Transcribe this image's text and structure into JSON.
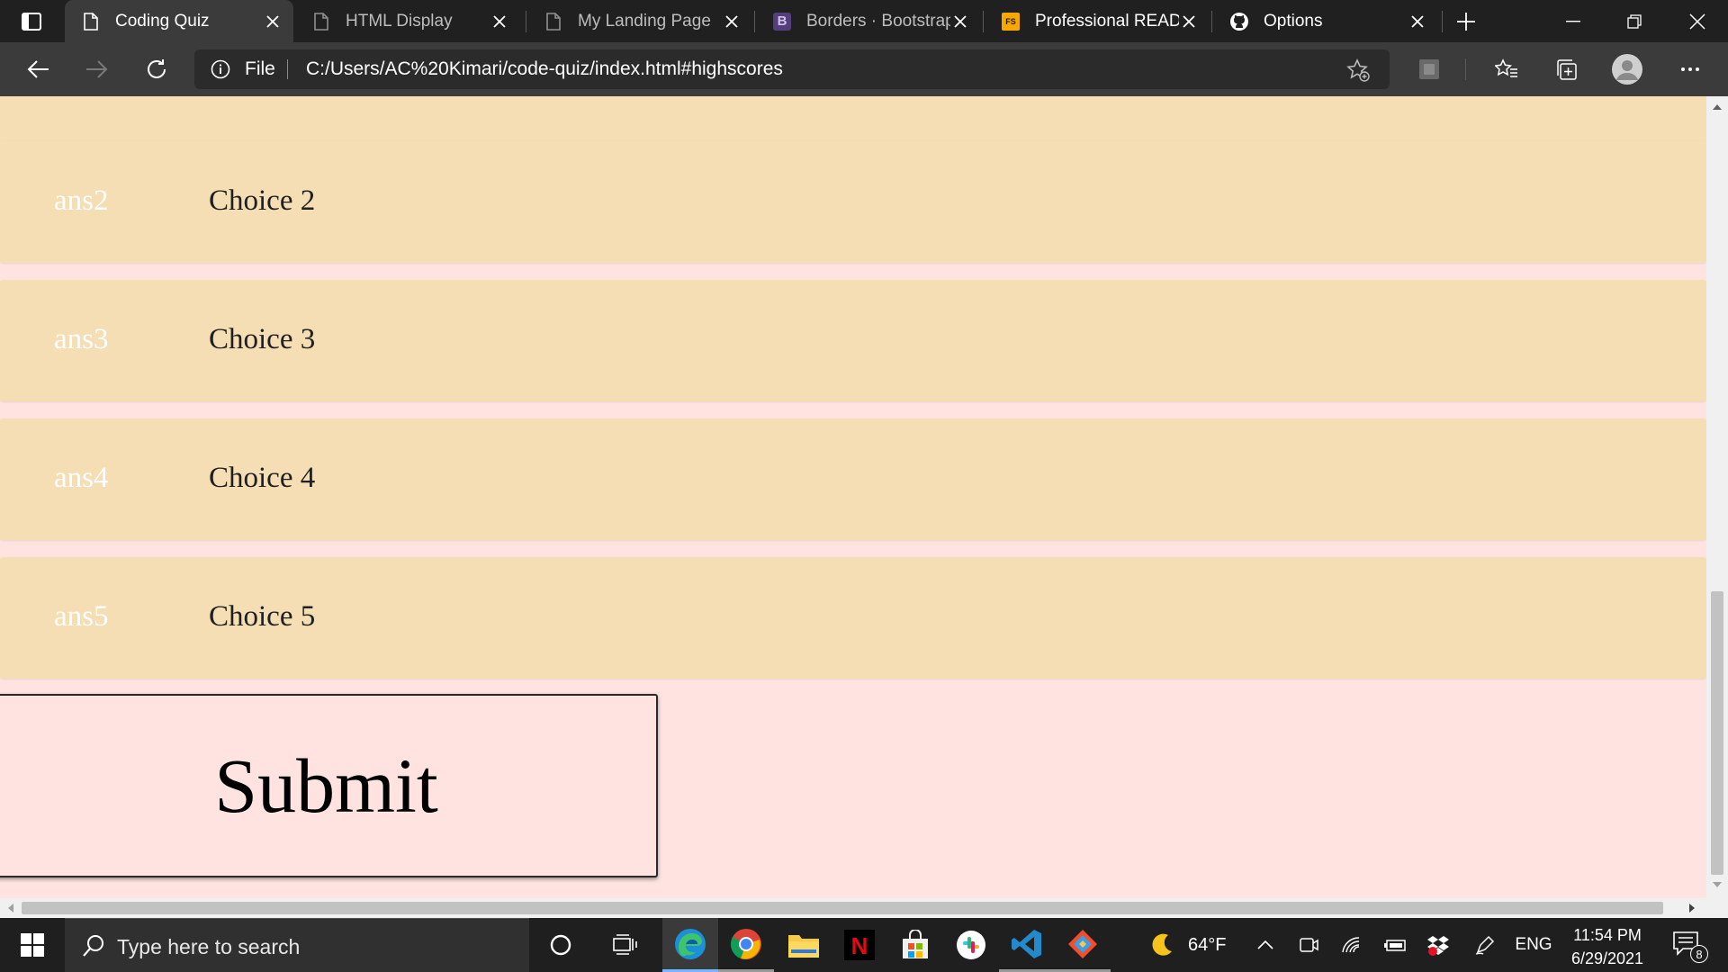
{
  "browser": {
    "tabs": [
      {
        "title": "Coding Quiz",
        "icon": "page-icon",
        "active": true
      },
      {
        "title": "HTML Display",
        "icon": "page-icon",
        "active": false
      },
      {
        "title": "My Landing Page",
        "icon": "page-icon",
        "active": false
      },
      {
        "title": "Borders · Bootstrap",
        "icon": "bootstrap-icon",
        "active": false
      },
      {
        "title": "Professional READM",
        "icon": "fs-icon",
        "active": false
      },
      {
        "title": "Options",
        "icon": "github-icon",
        "active": false
      }
    ],
    "bootstrap_badge": "B",
    "fs_badge": "FS",
    "address": {
      "scheme_label": "File",
      "url": "C:/Users/AC%20Kimari/code-quiz/index.html#highscores"
    }
  },
  "page": {
    "answers": [
      {
        "id": "ans2",
        "text": "Choice 2"
      },
      {
        "id": "ans3",
        "text": "Choice 3"
      },
      {
        "id": "ans4",
        "text": "Choice 4"
      },
      {
        "id": "ans5",
        "text": "Choice 5"
      }
    ],
    "submit_label": "Submit"
  },
  "taskbar": {
    "search_placeholder": "Type here to search",
    "weather_temp": "64°F",
    "language": "ENG",
    "time": "11:54 PM",
    "date": "6/29/2021",
    "notification_count": "8",
    "netflix_badge": "N"
  },
  "colors": {
    "page_bg": "#ffe3e1",
    "answer_bg": "#f5deb3",
    "chrome_bg": "#202020",
    "toolbar_bg": "#3b3b3b",
    "taskbar_bg": "#1f1f1f"
  }
}
